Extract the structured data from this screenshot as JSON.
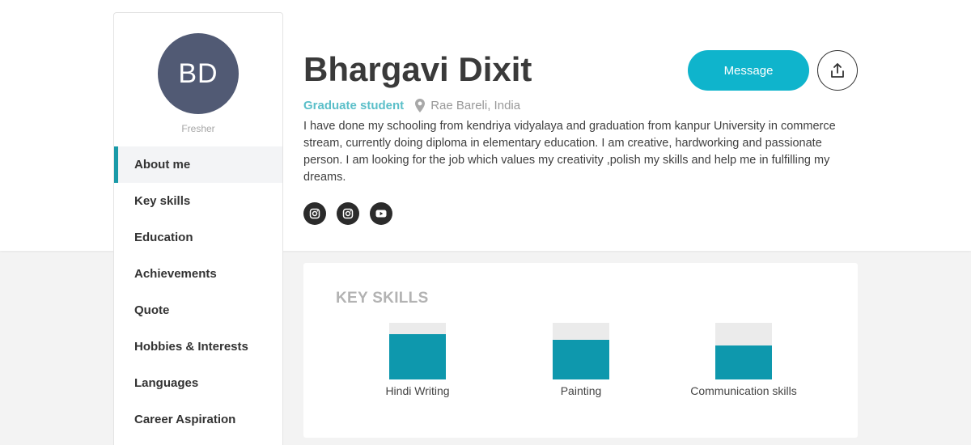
{
  "profile": {
    "initials": "BD",
    "level": "Fresher",
    "name": "Bhargavi Dixit",
    "role": "Graduate student",
    "location": "Rae Bareli, India",
    "bio": "I have done my schooling from kendriya vidyalaya and graduation from kanpur University in commerce stream, currently doing diploma in elementary education. I am creative, hardworking and passionate person. I am looking for the job which values my creativity ,polish my skills and help me in fulfilling my dreams."
  },
  "actions": {
    "message_label": "Message",
    "share_icon": "share-icon"
  },
  "socials": [
    {
      "icon": "instagram-icon"
    },
    {
      "icon": "instagram-icon"
    },
    {
      "icon": "youtube-icon"
    }
  ],
  "sidebar": {
    "items": [
      {
        "label": "About me",
        "active": true
      },
      {
        "label": "Key skills",
        "active": false
      },
      {
        "label": "Education",
        "active": false
      },
      {
        "label": "Achievements",
        "active": false
      },
      {
        "label": "Quote",
        "active": false
      },
      {
        "label": "Hobbies & Interests",
        "active": false
      },
      {
        "label": "Languages",
        "active": false
      },
      {
        "label": "Career Aspiration",
        "active": false
      }
    ]
  },
  "skills": {
    "title": "KEY SKILLS",
    "items": [
      {
        "label": "Hindi Writing",
        "level": 0.8
      },
      {
        "label": "Painting",
        "level": 0.7
      },
      {
        "label": "Communication skills",
        "level": 0.6
      }
    ]
  },
  "colors": {
    "accent": "#0fb4cc",
    "skill_fill": "#0e98ad",
    "avatar": "#515a74",
    "role": "#5bbfc9"
  }
}
